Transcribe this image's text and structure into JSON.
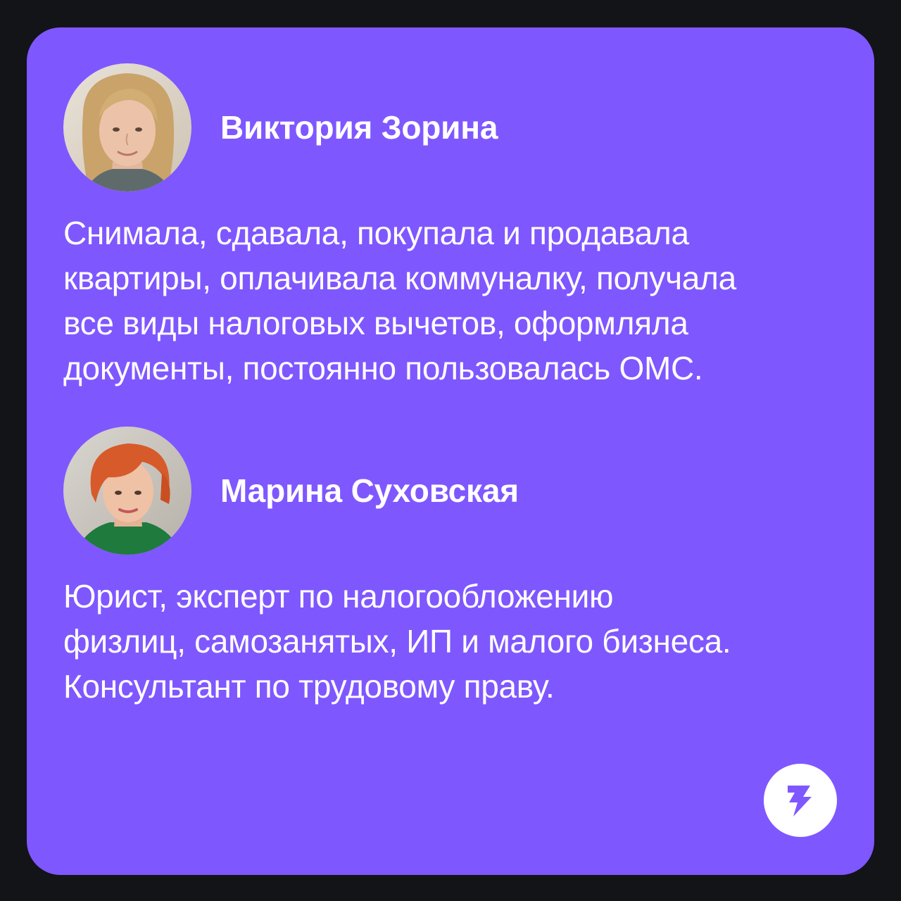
{
  "colors": {
    "background": "#131418",
    "card": "#7f57ff",
    "text": "#ffffff",
    "logo_circle": "#ffffff",
    "logo_bolt": "#7f57ff"
  },
  "people": [
    {
      "name": "Виктория Зорина",
      "bio_lines": [
        "Снимала, сдавала, покупала и продавала",
        "квартиры, оплачивала коммуналку, получала",
        "все виды налоговых вычетов, оформляла",
        "документы, постоянно пользовалась ОМС."
      ]
    },
    {
      "name": "Марина Суховская",
      "bio_lines": [
        "Юрист, эксперт по налогообложению",
        "физлиц, самозанятых, ИП и малого бизнеса.",
        "Консультант по трудовому праву."
      ]
    }
  ],
  "logo": {
    "icon": "lightning-bolt-icon"
  }
}
